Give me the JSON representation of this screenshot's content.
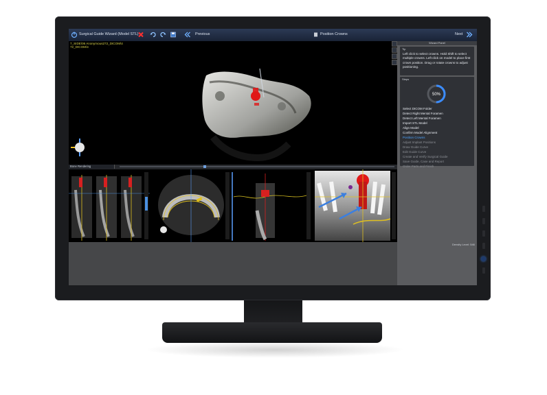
{
  "toolbar": {
    "title": "Surgical Guide Wizard (Model STL)",
    "previous_label": "Previous",
    "step_label": "Position Crowns",
    "next_label": "Next"
  },
  "view3d": {
    "path_lines": "7_SIDE\\06 Anonymous272_DICOM\\4\n72_DICOM\\4"
  },
  "lower_bar": {
    "preset_label": "Bone Rendering"
  },
  "wizard": {
    "header": "Wizard Panel",
    "tip_header": "Tip",
    "tip_text": "Left click to select crowns. Hold Shift to select multiple crowns. Left click on model to place first crown position. Drag or rotate crowns to adjust positioning.",
    "steps_header": "Steps",
    "progress": "50%",
    "progress_fraction": 0.5,
    "steps": [
      {
        "label": "Select DICOM Folder",
        "state": "done"
      },
      {
        "label": "Detect Right Mental Foramen",
        "state": "done"
      },
      {
        "label": "Detect Left Mental Foramen",
        "state": "done"
      },
      {
        "label": "Import STL Model",
        "state": "done"
      },
      {
        "label": "Align Model",
        "state": "done"
      },
      {
        "label": "Confirm Model Alignment",
        "state": "done"
      },
      {
        "label": "Position Crowns",
        "state": "current"
      },
      {
        "label": "Adjust Implant Positions",
        "state": "pending"
      },
      {
        "label": "Draw Guide Curve",
        "state": "pending"
      },
      {
        "label": "Edit Guide Curve",
        "state": "pending"
      },
      {
        "label": "Create and Verify Surgical Guide",
        "state": "pending"
      },
      {
        "label": "Save Guide, Case and Report",
        "state": "pending"
      },
      {
        "label": "Order Parts and Finish",
        "state": "pending"
      }
    ]
  },
  "status": {
    "density": "Density Level: 546"
  },
  "colors": {
    "accent": "#3b8cff",
    "current_step": "#4aa3ff",
    "done_step": "#e8ecf2",
    "pending_step": "#8d9096",
    "crown": "#e01818"
  }
}
